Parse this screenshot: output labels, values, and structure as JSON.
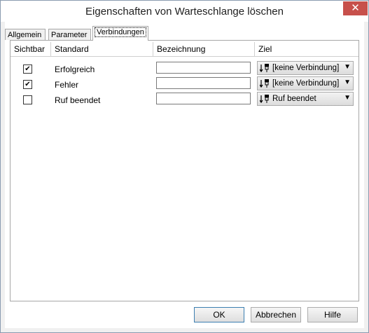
{
  "window": {
    "title": "Eigenschaften von Warteschlange löschen",
    "close_glyph": "✕"
  },
  "tabs": [
    {
      "label": "Allgemein"
    },
    {
      "label": "Parameter"
    },
    {
      "label": "Verbindungen",
      "active": true
    }
  ],
  "table": {
    "headers": [
      "Sichtbar",
      "Standard",
      "Bezeichnung",
      "Ziel"
    ],
    "rows": [
      {
        "visible": true,
        "check": "✔",
        "standard": "Erfolgreich",
        "bezeichnung": "",
        "ziel": "[keine Verbindung]",
        "icon": "connector-icon"
      },
      {
        "visible": true,
        "check": "✔",
        "standard": "Fehler",
        "bezeichnung": "",
        "ziel": "[keine Verbindung]",
        "icon": "connector-icon"
      },
      {
        "visible": false,
        "check": "",
        "standard": "Ruf beendet",
        "bezeichnung": "",
        "ziel": "Ruf beendet",
        "icon": "connector-icon"
      }
    ]
  },
  "buttons": {
    "ok": "OK",
    "cancel": "Abbrechen",
    "help": "Hilfe"
  }
}
